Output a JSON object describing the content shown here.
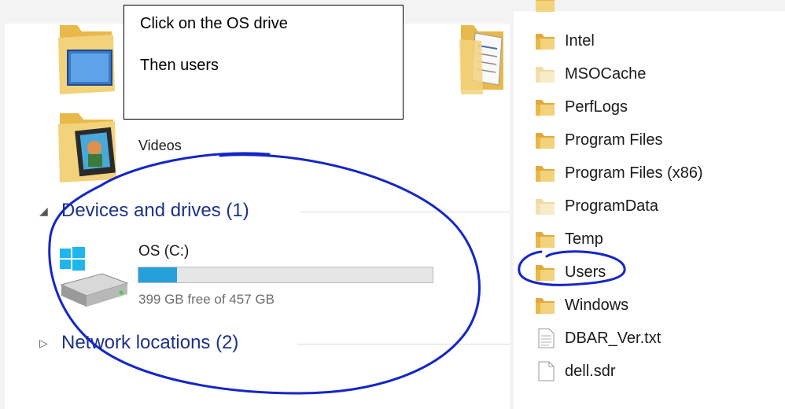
{
  "callout": {
    "line1": "Click on the OS drive",
    "line2": "Then users"
  },
  "library": {
    "videos_label": "Videos"
  },
  "sections": {
    "devices_header": "Devices and drives (1)",
    "network_header": "Network locations (2)"
  },
  "drive": {
    "name": "OS (C:)",
    "free_text": "399 GB free of 457 GB",
    "used_fraction": 0.13
  },
  "files": [
    {
      "label": "Intel",
      "icon": "folder-icon"
    },
    {
      "label": "MSOCache",
      "icon": "folder-hidden-icon"
    },
    {
      "label": "PerfLogs",
      "icon": "folder-icon"
    },
    {
      "label": "Program Files",
      "icon": "folder-icon"
    },
    {
      "label": "Program Files (x86)",
      "icon": "folder-icon"
    },
    {
      "label": "ProgramData",
      "icon": "folder-hidden-icon"
    },
    {
      "label": "Temp",
      "icon": "folder-icon"
    },
    {
      "label": "Users",
      "icon": "folder-icon"
    },
    {
      "label": "Windows",
      "icon": "folder-icon"
    },
    {
      "label": "DBAR_Ver.txt",
      "icon": "text-file-icon"
    },
    {
      "label": "dell.sdr",
      "icon": "file-icon"
    }
  ],
  "colors": {
    "accent": "#26a0da",
    "section_header": "#1e3287",
    "annotation_ink": "#1426c8",
    "folder": "#e8b84a"
  }
}
